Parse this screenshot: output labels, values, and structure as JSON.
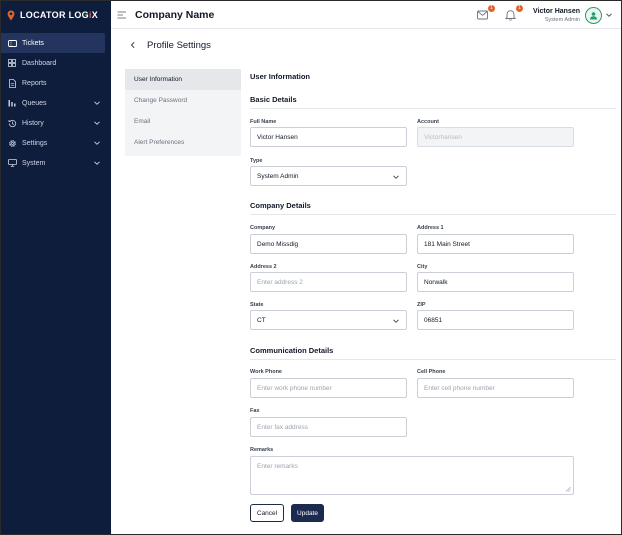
{
  "app": {
    "logo_text_left": "LOCATOR LOG",
    "logo_text_accent": "i",
    "logo_text_right": "X",
    "company_name": "Company Name"
  },
  "sidebar": {
    "items": [
      {
        "label": "Tickets",
        "icon": "ticket-icon",
        "active": true,
        "expandable": false
      },
      {
        "label": "Dashboard",
        "icon": "grid-icon",
        "active": false,
        "expandable": false
      },
      {
        "label": "Reports",
        "icon": "document-icon",
        "active": false,
        "expandable": false
      },
      {
        "label": "Queues",
        "icon": "bars-icon",
        "active": false,
        "expandable": true
      },
      {
        "label": "History",
        "icon": "history-icon",
        "active": false,
        "expandable": true
      },
      {
        "label": "Settings",
        "icon": "gear-icon",
        "active": false,
        "expandable": true
      },
      {
        "label": "System",
        "icon": "monitor-icon",
        "active": false,
        "expandable": true
      }
    ]
  },
  "header": {
    "mail_badge": "1",
    "bell_badge": "1",
    "user_name": "Victor Hansen",
    "user_role": "System Admin"
  },
  "page": {
    "title": "Profile Settings"
  },
  "tabs": [
    {
      "label": "User Information",
      "active": true
    },
    {
      "label": "Change Password",
      "active": false
    },
    {
      "label": "Email",
      "active": false
    },
    {
      "label": "Alert Preferences",
      "active": false
    }
  ],
  "form": {
    "section_title": "User Information",
    "basic": {
      "heading": "Basic Details",
      "full_name_label": "Full Name",
      "full_name_value": "Victor Hansen",
      "account_label": "Account",
      "account_value": "Victorhansen",
      "type_label": "Type",
      "type_value": "System Admin"
    },
    "company": {
      "heading": "Company Details",
      "company_label": "Company",
      "company_value": "Demo Missdig",
      "address1_label": "Address 1",
      "address1_value": "181 Main Street",
      "address2_label": "Address 2",
      "address2_placeholder": "Enter address 2",
      "city_label": "City",
      "city_value": "Norwalk",
      "state_label": "State",
      "state_value": "CT",
      "zip_label": "ZIP",
      "zip_value": "06851"
    },
    "communication": {
      "heading": "Communication Details",
      "work_phone_label": "Work Phone",
      "work_phone_placeholder": "Enter work phone number",
      "cell_phone_label": "Cell Phone",
      "cell_phone_placeholder": "Enter cell phone number",
      "fax_label": "Fax",
      "fax_placeholder": "Enter fax address",
      "remarks_label": "Remarks",
      "remarks_placeholder": "Enter remarks"
    },
    "buttons": {
      "cancel": "Cancel",
      "update": "Update"
    }
  },
  "colors": {
    "sidebar_bg": "#0f1d3d",
    "accent_orange": "#e0622b",
    "avatar_ring": "#22a06b",
    "primary_button": "#1b2a4e"
  }
}
